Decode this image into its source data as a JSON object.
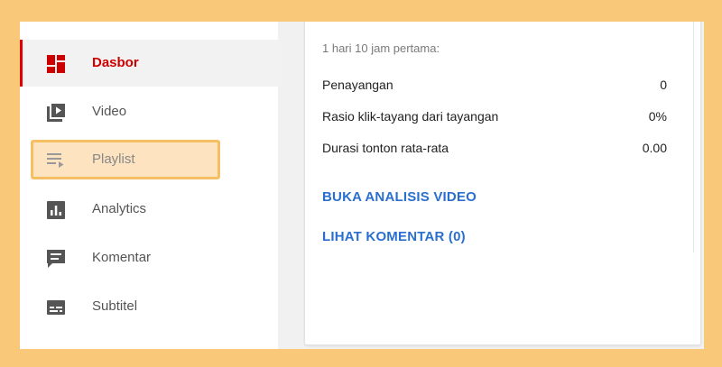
{
  "sidebar": {
    "items": [
      {
        "label": "Dasbor",
        "icon": "dashboard-icon"
      },
      {
        "label": "Video",
        "icon": "video-library-icon"
      },
      {
        "label": "Playlist",
        "icon": "playlist-icon"
      },
      {
        "label": "Analytics",
        "icon": "analytics-icon"
      },
      {
        "label": "Komentar",
        "icon": "comment-icon"
      },
      {
        "label": "Subtitel",
        "icon": "subtitles-icon"
      }
    ]
  },
  "stats": {
    "subtitle": "1 hari 10 jam pertama:",
    "rows": [
      {
        "label": "Penayangan",
        "value": "0"
      },
      {
        "label": "Rasio klik-tayang dari tayangan",
        "value": "0%"
      },
      {
        "label": "Durasi tonton rata-rata",
        "value": "0.00"
      }
    ]
  },
  "links": {
    "analytics": "BUKA ANALISIS VIDEO",
    "comments": "LIHAT KOMENTAR (0)"
  },
  "colors": {
    "background": "#f9c878",
    "accent_red": "#cc0000",
    "link_blue": "#2a6fcf",
    "highlight_fill": "#fde3c0",
    "highlight_border": "#f5bf63"
  }
}
